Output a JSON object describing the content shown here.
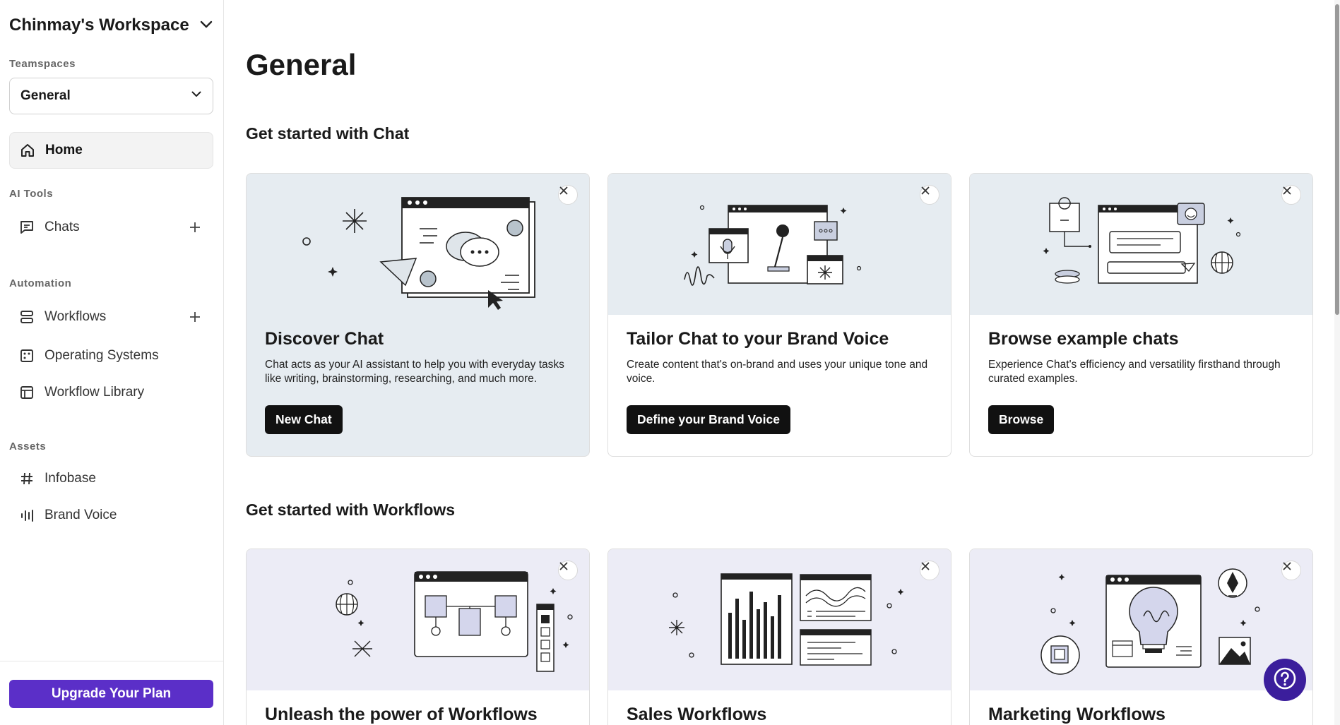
{
  "sidebar": {
    "workspace_title": "Chinmay's Workspace",
    "teamspaces_label": "Teamspaces",
    "teamspace_selected": "General",
    "home_label": "Home",
    "ai_tools_label": "AI Tools",
    "chats_label": "Chats",
    "automation_label": "Automation",
    "workflows_label": "Workflows",
    "operating_systems_label": "Operating Systems",
    "workflow_library_label": "Workflow Library",
    "assets_label": "Assets",
    "infobase_label": "Infobase",
    "brand_voice_label": "Brand Voice",
    "upgrade_label": "Upgrade Your Plan"
  },
  "main": {
    "page_title": "General",
    "chat_section_title": "Get started with Chat",
    "chat_cards": [
      {
        "title": "Discover Chat",
        "desc": "Chat acts as your AI assistant to help you with everyday tasks like writing, brainstorming, researching, and much more.",
        "button": "New Chat"
      },
      {
        "title": "Tailor Chat to your Brand Voice",
        "desc": "Create content that's on-brand and uses your unique tone and voice.",
        "button": "Define your Brand Voice"
      },
      {
        "title": "Browse example chats",
        "desc": "Experience Chat's efficiency and versatility firsthand through curated examples.",
        "button": "Browse"
      }
    ],
    "workflow_section_title": "Get started with Workflows",
    "workflow_cards": [
      {
        "title": "Unleash the power of Workflows"
      },
      {
        "title": "Sales Workflows"
      },
      {
        "title": "Marketing Workflows"
      }
    ]
  },
  "colors": {
    "accent": "#5b2fc8",
    "help_button": "#3b1e9c",
    "chat_card_tint": "#e6ecf1",
    "workflow_card_tint": "#ececf6"
  },
  "icons": [
    "chevron-down-icon",
    "home-icon",
    "chat-icon",
    "plus-icon",
    "workflow-icon",
    "os-icon",
    "library-icon",
    "hash-icon",
    "voice-bars-icon",
    "close-icon",
    "help-icon"
  ]
}
